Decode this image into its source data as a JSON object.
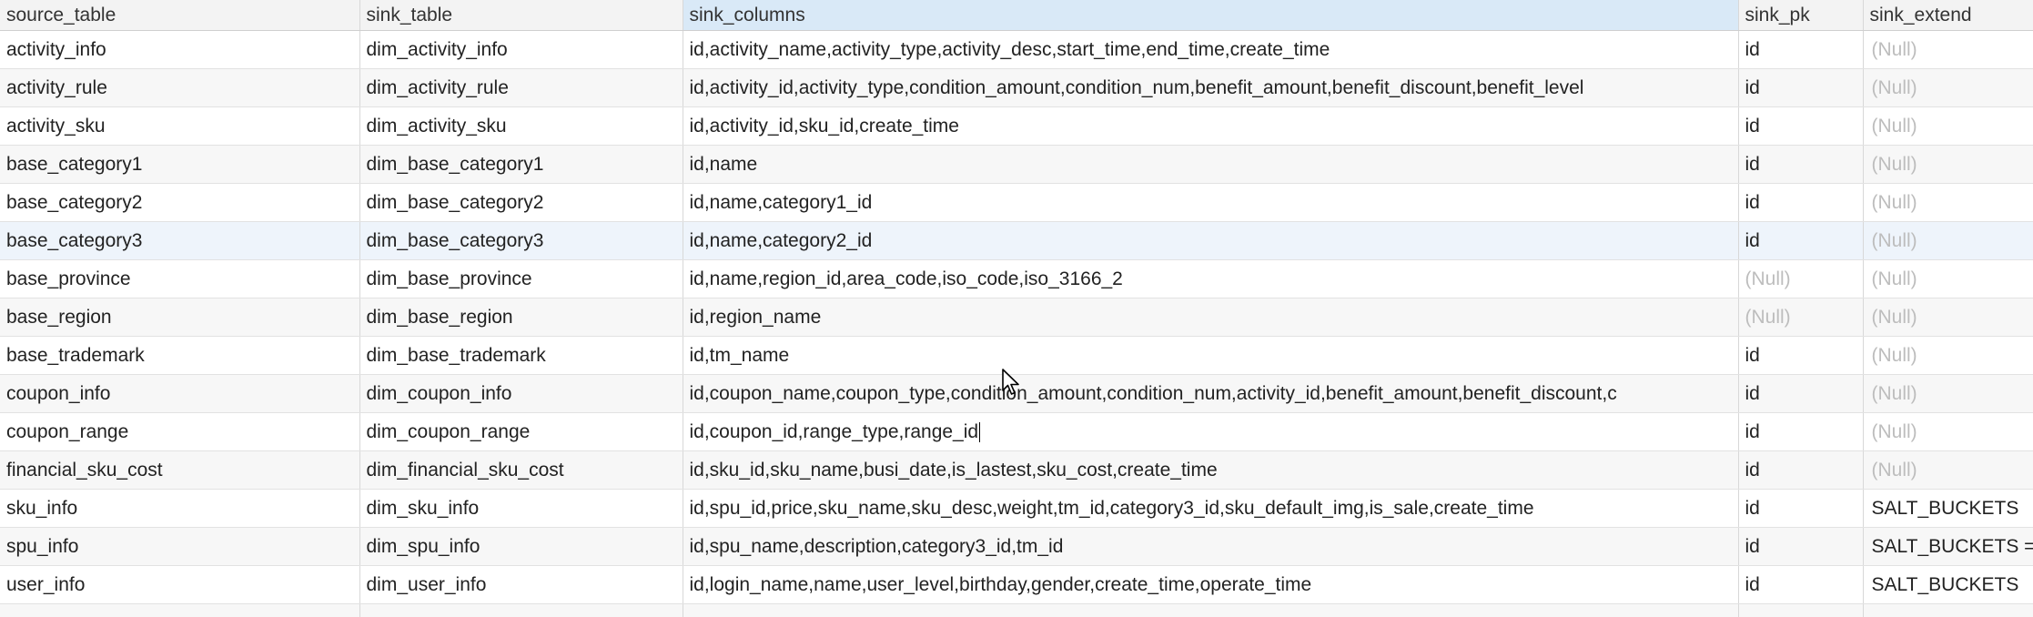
{
  "headers": {
    "source_table": "source_table",
    "sink_table": "sink_table",
    "sink_columns": "sink_columns",
    "sink_pk": "sink_pk",
    "sink_extend": "sink_extend"
  },
  "rows": [
    {
      "source_table": "activity_info",
      "sink_table": "dim_activity_info",
      "sink_columns": "id,activity_name,activity_type,activity_desc,start_time,end_time,create_time",
      "sink_pk": "id",
      "sink_extend": "(Null)"
    },
    {
      "source_table": "activity_rule",
      "sink_table": "dim_activity_rule",
      "sink_columns": "id,activity_id,activity_type,condition_amount,condition_num,benefit_amount,benefit_discount,benefit_level",
      "sink_pk": "id",
      "sink_extend": "(Null)"
    },
    {
      "source_table": "activity_sku",
      "sink_table": "dim_activity_sku",
      "sink_columns": "id,activity_id,sku_id,create_time",
      "sink_pk": "id",
      "sink_extend": "(Null)"
    },
    {
      "source_table": "base_category1",
      "sink_table": "dim_base_category1",
      "sink_columns": "id,name",
      "sink_pk": "id",
      "sink_extend": "(Null)"
    },
    {
      "source_table": "base_category2",
      "sink_table": "dim_base_category2",
      "sink_columns": "id,name,category1_id",
      "sink_pk": "id",
      "sink_extend": "(Null)"
    },
    {
      "source_table": "base_category3",
      "sink_table": "dim_base_category3",
      "sink_columns": "id,name,category2_id",
      "sink_pk": "id",
      "sink_extend": "(Null)"
    },
    {
      "source_table": "base_province",
      "sink_table": "dim_base_province",
      "sink_columns": "id,name,region_id,area_code,iso_code,iso_3166_2",
      "sink_pk": "(Null)",
      "sink_extend": "(Null)"
    },
    {
      "source_table": "base_region",
      "sink_table": "dim_base_region",
      "sink_columns": "id,region_name",
      "sink_pk": "(Null)",
      "sink_extend": "(Null)"
    },
    {
      "source_table": "base_trademark",
      "sink_table": "dim_base_trademark",
      "sink_columns": "id,tm_name",
      "sink_pk": "id",
      "sink_extend": "(Null)"
    },
    {
      "source_table": "coupon_info",
      "sink_table": "dim_coupon_info",
      "sink_columns": "id,coupon_name,coupon_type,condition_amount,condition_num,activity_id,benefit_amount,benefit_discount,c",
      "sink_pk": "id",
      "sink_extend": "(Null)"
    },
    {
      "source_table": "coupon_range",
      "sink_table": "dim_coupon_range",
      "sink_columns": "id,coupon_id,range_type,range_id",
      "sink_pk": "id",
      "sink_extend": "(Null)"
    },
    {
      "source_table": "financial_sku_cost",
      "sink_table": "dim_financial_sku_cost",
      "sink_columns": "id,sku_id,sku_name,busi_date,is_lastest,sku_cost,create_time",
      "sink_pk": "id",
      "sink_extend": "(Null)"
    },
    {
      "source_table": "sku_info",
      "sink_table": "dim_sku_info",
      "sink_columns": "id,spu_id,price,sku_name,sku_desc,weight,tm_id,category3_id,sku_default_img,is_sale,create_time",
      "sink_pk": "id",
      "sink_extend": "SALT_BUCKETS"
    },
    {
      "source_table": "spu_info",
      "sink_table": "dim_spu_info",
      "sink_columns": "id,spu_name,description,category3_id,tm_id",
      "sink_pk": "id",
      "sink_extend": "SALT_BUCKETS ="
    },
    {
      "source_table": "user_info",
      "sink_table": "dim_user_info",
      "sink_columns": "id,login_name,name,user_level,birthday,gender,create_time,operate_time",
      "sink_pk": "id",
      "sink_extend": "SALT_BUCKETS"
    }
  ],
  "colors": {
    "null_text": "#bdbdbd",
    "header_active": "#d9e9f7",
    "row_highlight": "#eef4fb"
  },
  "icons": {
    "mouse_pointer": "arrow-cursor-icon",
    "text_caret": "text-caret"
  }
}
